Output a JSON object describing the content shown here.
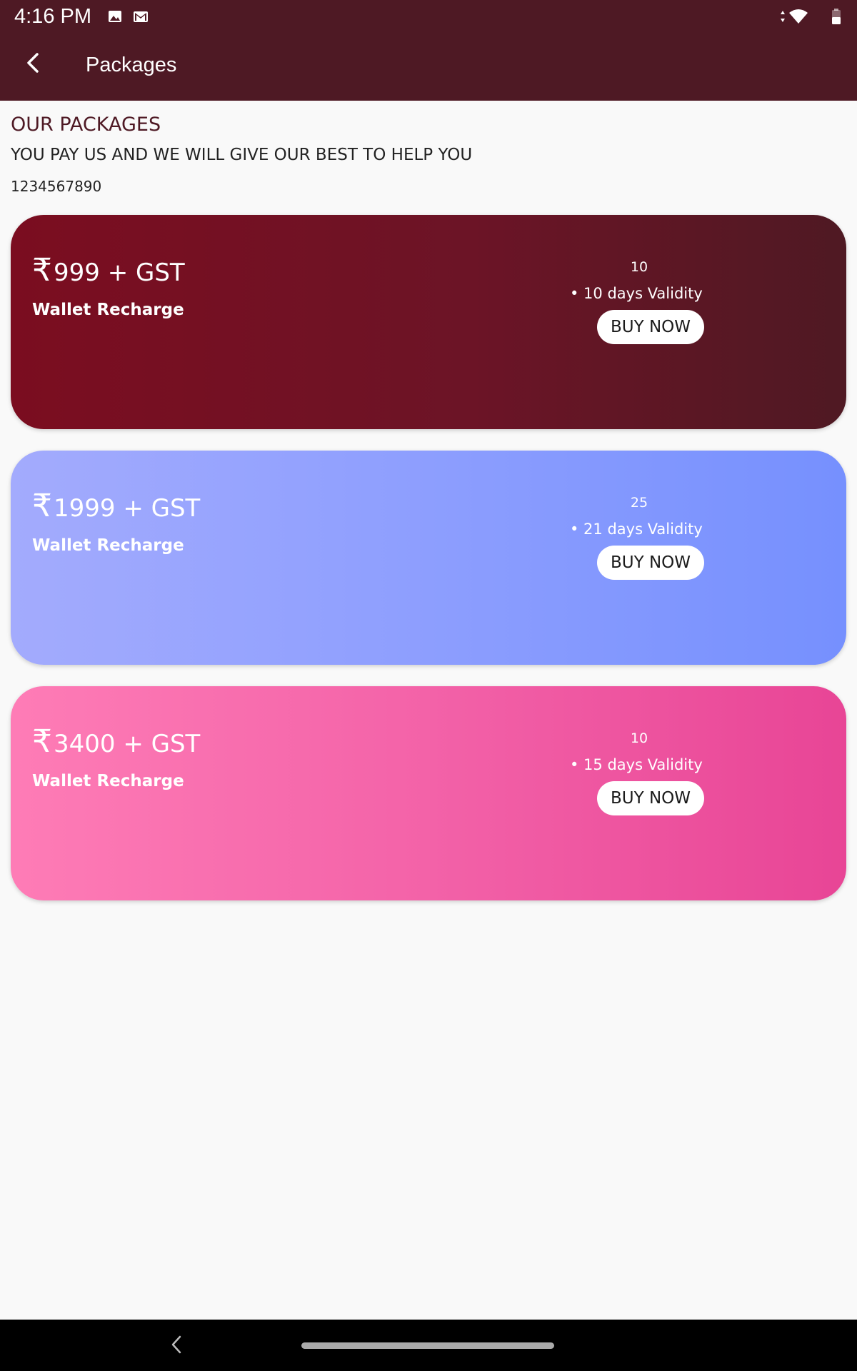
{
  "status_bar": {
    "time": "4:16 PM",
    "icons": [
      "image-icon",
      "gmail-icon",
      "data-arrows-icon",
      "wifi-icon",
      "battery-icon"
    ]
  },
  "app_bar": {
    "title": "Packages",
    "back_icon": "back-arrow-icon"
  },
  "intro": {
    "heading": "OUR PACKAGES",
    "subheading": "YOU PAY US AND WE WILL GIVE OUR BEST TO HELP YOU",
    "phone": "1234567890"
  },
  "packages": [
    {
      "currency": "₹",
      "price": "999 + GST",
      "type": "Wallet Recharge",
      "count": "10",
      "validity": "• 10 days Validity",
      "button_label": "BUY NOW",
      "colors": [
        "#7b0d20",
        "#4f1923"
      ]
    },
    {
      "currency": "₹",
      "price": "1999 + GST",
      "type": "Wallet Recharge",
      "count": "25",
      "validity": "• 21 days Validity",
      "button_label": "BUY NOW",
      "colors": [
        "#a3abfd",
        "#7690fe"
      ]
    },
    {
      "currency": "₹",
      "price": "3400 + GST",
      "type": "Wallet Recharge",
      "count": "10",
      "validity": "• 15 days Validity",
      "button_label": "BUY NOW",
      "colors": [
        "#fe7cb6",
        "#e84596"
      ]
    }
  ],
  "theme": {
    "primary": "#4e1924",
    "background": "#f9f9f9"
  }
}
